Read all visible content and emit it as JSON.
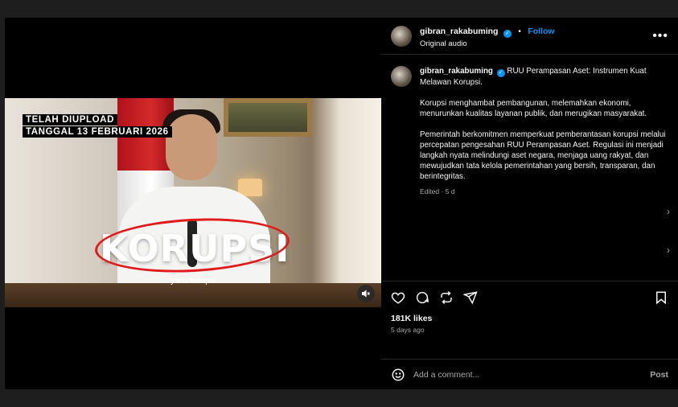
{
  "post": {
    "username": "gibran_rakabuming",
    "follow_label": "Follow",
    "dot": "•",
    "audio": "Original audio",
    "more": "•••"
  },
  "video": {
    "top_caption_line1": "TELAH DIUPLOAD",
    "top_caption_line2": "TANGGAL 13 FEBRUARI 2026",
    "overlay_word": "KORUPSI",
    "subtitle": "yaitu korupsi."
  },
  "caption": {
    "username": "gibran_rakabuming",
    "title": "RUU Perampasan Aset: Instrumen Kuat Melawan Korupsi.",
    "para1": "Korupsi menghambat pembangunan, melemahkan ekonomi, menurunkan kualitas layanan publik, dan merugikan masyarakat.",
    "para2": "Pemerintah berkomitmen memperkuat pemberantasan korupsi melalui percepatan pengesahan RUU Perampasan Aset. Regulasi ini menjadi langkah nyata melindungi aset negara, menjaga uang rakyat, dan mewujudkan tata kelola pemerintahan yang bersih, transparan, dan berintegritas.",
    "edited": "Edited · 5 d"
  },
  "engagement": {
    "likes": "181K likes",
    "ago": "5 days ago"
  },
  "comment": {
    "placeholder": "Add a comment...",
    "post_label": "Post"
  },
  "colors": {
    "accent": "#0095f6",
    "background": "#000000",
    "ring": "#e01b1b"
  }
}
